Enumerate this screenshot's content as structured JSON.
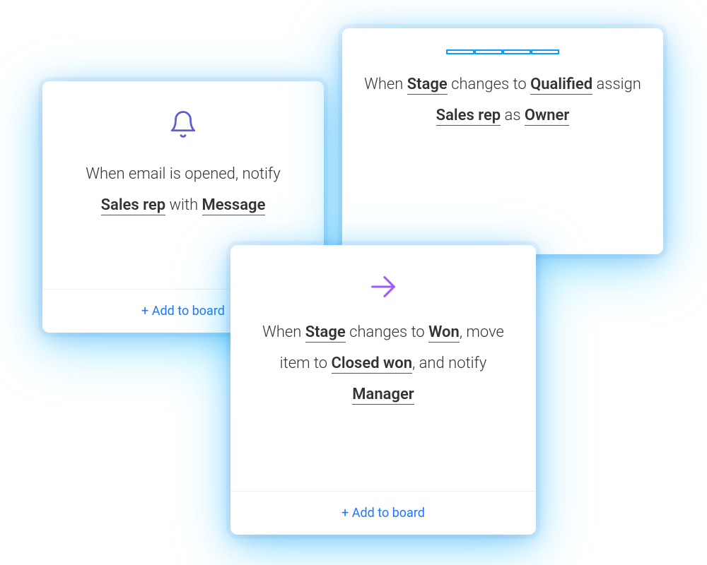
{
  "cards": {
    "bell": {
      "text_prefix": "When email is opened, notify ",
      "var1": "Sales rep",
      "mid1": " with ",
      "var2": "Message",
      "add_label": "+ Add to board"
    },
    "list": {
      "prefix": "When ",
      "v1": "Stage",
      "m1": " changes to ",
      "v2": "Qualified",
      "m2": " assign ",
      "v3": "Sales rep",
      "m3": " as ",
      "v4": "Owner"
    },
    "arrow": {
      "prefix": "When ",
      "v1": "Stage",
      "m1": " changes to ",
      "v2": "Won",
      "m2": ", move item to ",
      "v3": "Closed won",
      "m3": ", and notify ",
      "v4": "Manager",
      "add_label": "+ Add to board"
    }
  },
  "colors": {
    "bell_icon": "#5b5fcf",
    "list_icon": "#0a9dff",
    "arrow_icon": "#a259ff",
    "link": "#1f76ff"
  }
}
